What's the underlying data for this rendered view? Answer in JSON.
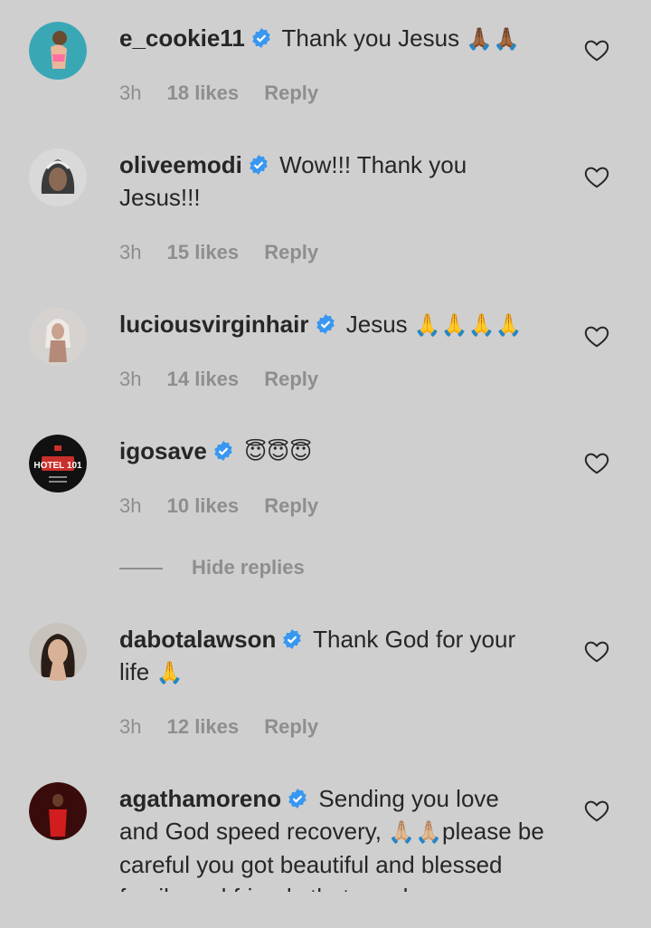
{
  "comments": [
    {
      "username": "e_cookie11",
      "text": "Thank you Jesus",
      "emoji": "🙏🏾🙏🏾",
      "time": "3h",
      "likes": "18 likes",
      "reply": "Reply"
    },
    {
      "username": "oliveemodi",
      "text": "Wow!!! Thank you Jesus!!!",
      "emoji": "",
      "time": "3h",
      "likes": "15 likes",
      "reply": "Reply"
    },
    {
      "username": "luciousvirginhair",
      "text": "Jesus",
      "emoji": "🙏🙏🙏🙏",
      "time": "3h",
      "likes": "14 likes",
      "reply": "Reply"
    },
    {
      "username": "igosave",
      "text": "",
      "emoji": "😇😇😇",
      "time": "3h",
      "likes": "10 likes",
      "reply": "Reply"
    },
    {
      "username": "dabotalawson",
      "text": "Thank God for your life",
      "emoji": "🙏",
      "time": "3h",
      "likes": "12 likes",
      "reply": "Reply"
    },
    {
      "username": "agathamoreno",
      "text": "Sending you love and God speed recovery,",
      "emoji": "🙏🏼🙏🏼",
      "text2": "please be careful you got beautiful and blessed family and friends that need"
    }
  ],
  "hide_replies": "Hide replies",
  "avatar4_text": "HOTEL 101",
  "colors": {
    "background": "#cfcfcf",
    "text": "#262626",
    "meta": "#8e8e8e",
    "verified": "#3897f0"
  }
}
